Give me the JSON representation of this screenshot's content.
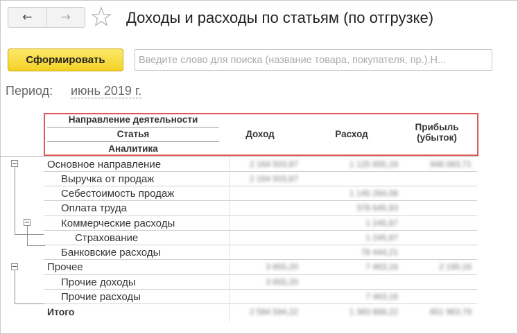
{
  "nav": {
    "back_icon": "←",
    "forward_icon": "→"
  },
  "title": "Доходы и расходы по статьям (по отгрузке)",
  "toolbar": {
    "generate_label": "Сформировать",
    "search_placeholder": "Введите слово для поиска (название товара, покупателя, пр.).Н..."
  },
  "period": {
    "label": "Период:",
    "value": "июнь 2019 г."
  },
  "table": {
    "header": {
      "group_lines": [
        "Направление деятельности",
        "Статья",
        "Аналитика"
      ],
      "income": "Доход",
      "expense": "Расход",
      "profit_line1": "Прибыль",
      "profit_line2": "(убыток)"
    },
    "rows": [
      {
        "label": "Основное направление",
        "income": "2 164 503,87",
        "expense": "1 125 655,16",
        "profit": "948 063,71"
      },
      {
        "label": "Выручка от продаж",
        "income": "2 164 503,87",
        "expense": "",
        "profit": ""
      },
      {
        "label": "Себестоимость продаж",
        "income": "",
        "expense": "1 145 264,06",
        "profit": ""
      },
      {
        "label": "Оплата труда",
        "income": "",
        "expense": "378 645,93",
        "profit": ""
      },
      {
        "label": "Коммерческие расходы",
        "income": "",
        "expense": "1 245,87",
        "profit": ""
      },
      {
        "label": "Страхование",
        "income": "",
        "expense": "1 245,87",
        "profit": ""
      },
      {
        "label": "Банковские расходы",
        "income": "",
        "expense": "78 444,21",
        "profit": ""
      },
      {
        "label": "Прочее",
        "income": "3 655,20",
        "expense": "7 463,16",
        "profit": "2 190,16"
      },
      {
        "label": "Прочие доходы",
        "income": "3 655,20",
        "expense": "",
        "profit": ""
      },
      {
        "label": "Прочие расходы",
        "income": "",
        "expense": "7 463,16",
        "profit": ""
      },
      {
        "label": "Итого",
        "income": "2 584 594,22",
        "expense": "1 383 868,22",
        "profit": "851 963,79"
      }
    ]
  },
  "colors": {
    "accent_button": "#f3d124",
    "highlight_border": "#e05757"
  }
}
